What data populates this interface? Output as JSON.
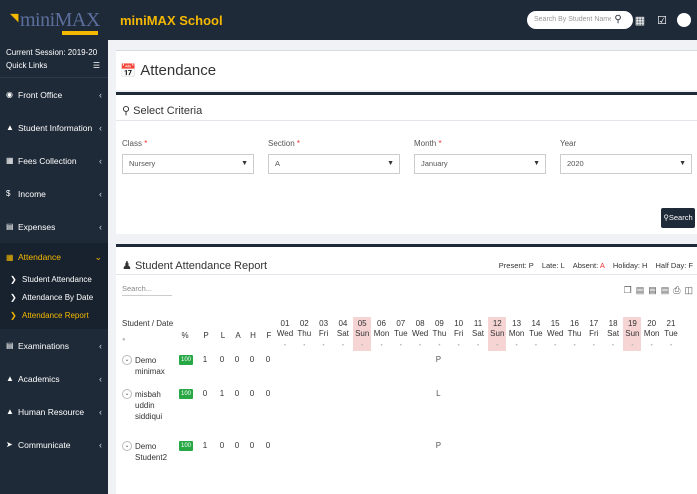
{
  "topbar": {
    "logo_text": "miniMAX",
    "school_name": "miniMAX School",
    "search_placeholder": "Search By Student Name"
  },
  "sidebar": {
    "session": "Current Session: 2019-20",
    "quick_links": "Quick Links",
    "items": [
      {
        "label": "Front Office",
        "icon": "person-icon"
      },
      {
        "label": "Student Information",
        "icon": "student-icon"
      },
      {
        "label": "Fees Collection",
        "icon": "fees-icon"
      },
      {
        "label": "Income",
        "icon": "dollar-icon"
      },
      {
        "label": "Expenses",
        "icon": "expense-icon"
      },
      {
        "label": "Attendance",
        "icon": "calendar-icon"
      }
    ],
    "sub_items": [
      "Student Attendance",
      "Attendance By Date",
      "Attendance Report"
    ],
    "items_after": [
      {
        "label": "Examinations",
        "icon": "exam-icon"
      },
      {
        "label": "Academics",
        "icon": "graduation-icon"
      },
      {
        "label": "Human Resource",
        "icon": "hr-icon"
      },
      {
        "label": "Communicate",
        "icon": "communicate-icon"
      }
    ]
  },
  "page": {
    "title": "Attendance"
  },
  "criteria": {
    "title": "Select Criteria",
    "fields": [
      {
        "label": "Class",
        "required": "*",
        "value": "Nursery"
      },
      {
        "label": "Section",
        "required": "*",
        "value": "A"
      },
      {
        "label": "Month",
        "required": "*",
        "value": "January"
      },
      {
        "label": "Year",
        "required": "",
        "value": "2020"
      }
    ],
    "search_label": "Search"
  },
  "report": {
    "title": "Student Attendance Report",
    "legend": {
      "present": "Present: P",
      "late": "Late: L",
      "absent_label": "Absent:",
      "absent_value": "A",
      "holiday": "Holiday: H",
      "half_day": "Half Day: F"
    },
    "search_placeholder": "Search...",
    "columns": {
      "student_date": "Student / Date",
      "percent": "%",
      "p": "P",
      "l": "L",
      "a": "A",
      "h": "H",
      "f": "F"
    },
    "days": [
      {
        "num": "01",
        "day": "Wed"
      },
      {
        "num": "02",
        "day": "Thu"
      },
      {
        "num": "03",
        "day": "Fri"
      },
      {
        "num": "04",
        "day": "Sat"
      },
      {
        "num": "05",
        "day": "Sun"
      },
      {
        "num": "06",
        "day": "Mon"
      },
      {
        "num": "07",
        "day": "Tue"
      },
      {
        "num": "08",
        "day": "Wed"
      },
      {
        "num": "09",
        "day": "Thu"
      },
      {
        "num": "10",
        "day": "Fri"
      },
      {
        "num": "11",
        "day": "Sat"
      },
      {
        "num": "12",
        "day": "Sun"
      },
      {
        "num": "13",
        "day": "Mon"
      },
      {
        "num": "14",
        "day": "Tue"
      },
      {
        "num": "15",
        "day": "Wed"
      },
      {
        "num": "16",
        "day": "Thu"
      },
      {
        "num": "17",
        "day": "Fri"
      },
      {
        "num": "18",
        "day": "Sat"
      },
      {
        "num": "19",
        "day": "Sun"
      },
      {
        "num": "20",
        "day": "Mon"
      },
      {
        "num": "21",
        "day": "Tue"
      }
    ],
    "rows": [
      {
        "name": [
          "Demo",
          "minimax"
        ],
        "percent": "100",
        "p": "1",
        "l": "0",
        "a": "0",
        "h": "0",
        "f": "0",
        "mark": "P"
      },
      {
        "name": [
          "misbah",
          "uddin",
          "siddiqui"
        ],
        "percent": "100",
        "p": "0",
        "l": "1",
        "a": "0",
        "h": "0",
        "f": "0",
        "mark": "L"
      },
      {
        "name": [
          "Demo",
          "Student2"
        ],
        "percent": "100",
        "p": "1",
        "l": "0",
        "a": "0",
        "h": "0",
        "f": "0",
        "mark": "P"
      }
    ]
  }
}
